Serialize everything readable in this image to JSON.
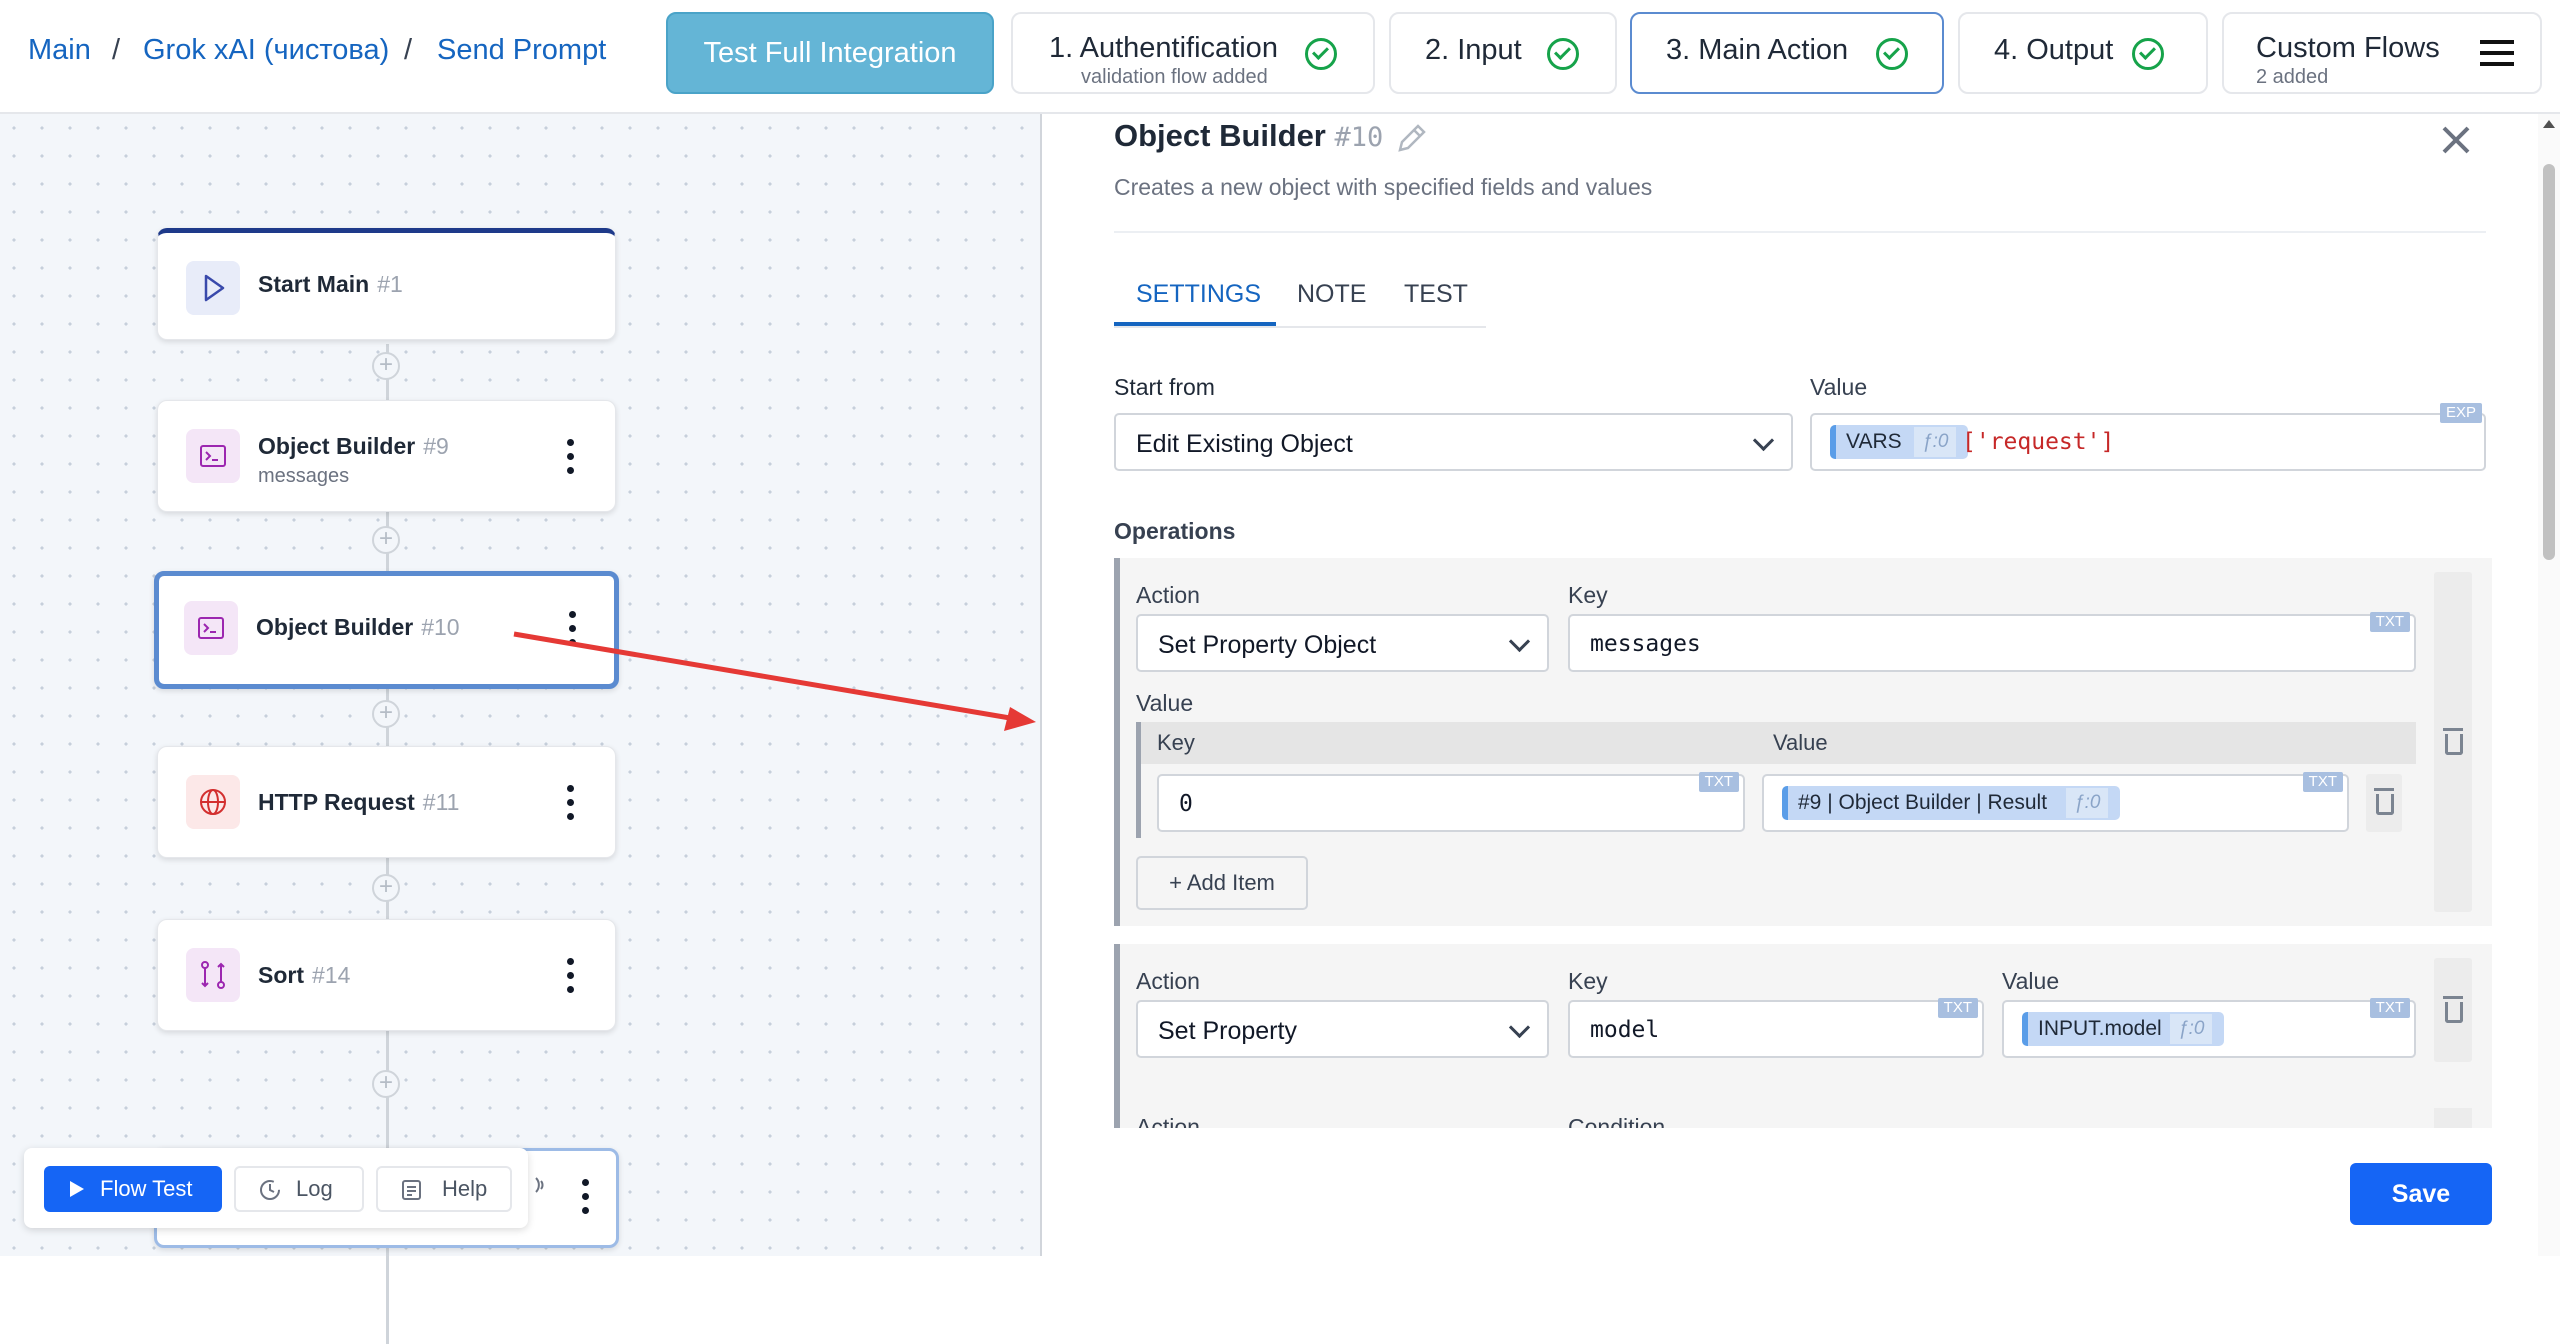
{
  "breadcrumb": {
    "main": "Main",
    "project": "Grok xAI (чистова)",
    "page": "Send Prompt",
    "sep": "/"
  },
  "header": {
    "test_full": "Test Full Integration",
    "steps": [
      {
        "label": "1. Authentification",
        "sub": "validation flow added"
      },
      {
        "label": "2. Input"
      },
      {
        "label": "3. Main Action"
      },
      {
        "label": "4. Output"
      },
      {
        "label": "Custom Flows",
        "sub": "2 added"
      }
    ]
  },
  "canvas": {
    "nodes": [
      {
        "title": "Start Main",
        "num": "#1"
      },
      {
        "title": "Object Builder",
        "num": "#9",
        "sub": "messages"
      },
      {
        "title": "Object Builder",
        "num": "#10"
      },
      {
        "title": "HTTP Request",
        "num": "#11"
      },
      {
        "title": "Sort",
        "num": "#14"
      }
    ],
    "plus": "+"
  },
  "toolbar": {
    "flow_test": "Flow Test",
    "log": "Log",
    "help": "Help"
  },
  "panel": {
    "title": "Object Builder",
    "num": "#10",
    "description": "Creates a new object with specified fields and values",
    "tabs": [
      "SETTINGS",
      "NOTE",
      "TEST"
    ],
    "start_from_label": "Start from",
    "start_from_value": "Edit Existing Object",
    "value_label": "Value",
    "value_badge": "EXP",
    "value_chip": "VARS",
    "value_chip_f": "ƒ:0",
    "value_expr": "['request']",
    "operations_label": "Operations",
    "op1": {
      "action_label": "Action",
      "action_value": "Set Property Object",
      "key_label": "Key",
      "key_value": "messages",
      "key_badge": "TXT",
      "value_label": "Value",
      "inner": {
        "key_label": "Key",
        "value_label": "Value",
        "key_value": "0",
        "key_badge": "TXT",
        "val_badge": "TXT",
        "val_chip": "#9 | Object Builder | Result",
        "val_chip_f": "ƒ:0"
      },
      "add_item": "+ Add Item"
    },
    "op2": {
      "action_label": "Action",
      "action_value": "Set Property",
      "key_label": "Key",
      "key_value": "model",
      "key_badge": "TXT",
      "value_label": "Value",
      "val_badge": "TXT",
      "val_chip": "INPUT.model",
      "val_chip_f": "ƒ:0"
    },
    "op3": {
      "action_label": "Action",
      "condition_label": "Condition"
    },
    "save": "Save"
  },
  "colors": {
    "primary": "#1565f5",
    "link": "#1565c0",
    "success": "#16a34a",
    "arrow": "#e53935",
    "selected": "#5b8bd0"
  }
}
